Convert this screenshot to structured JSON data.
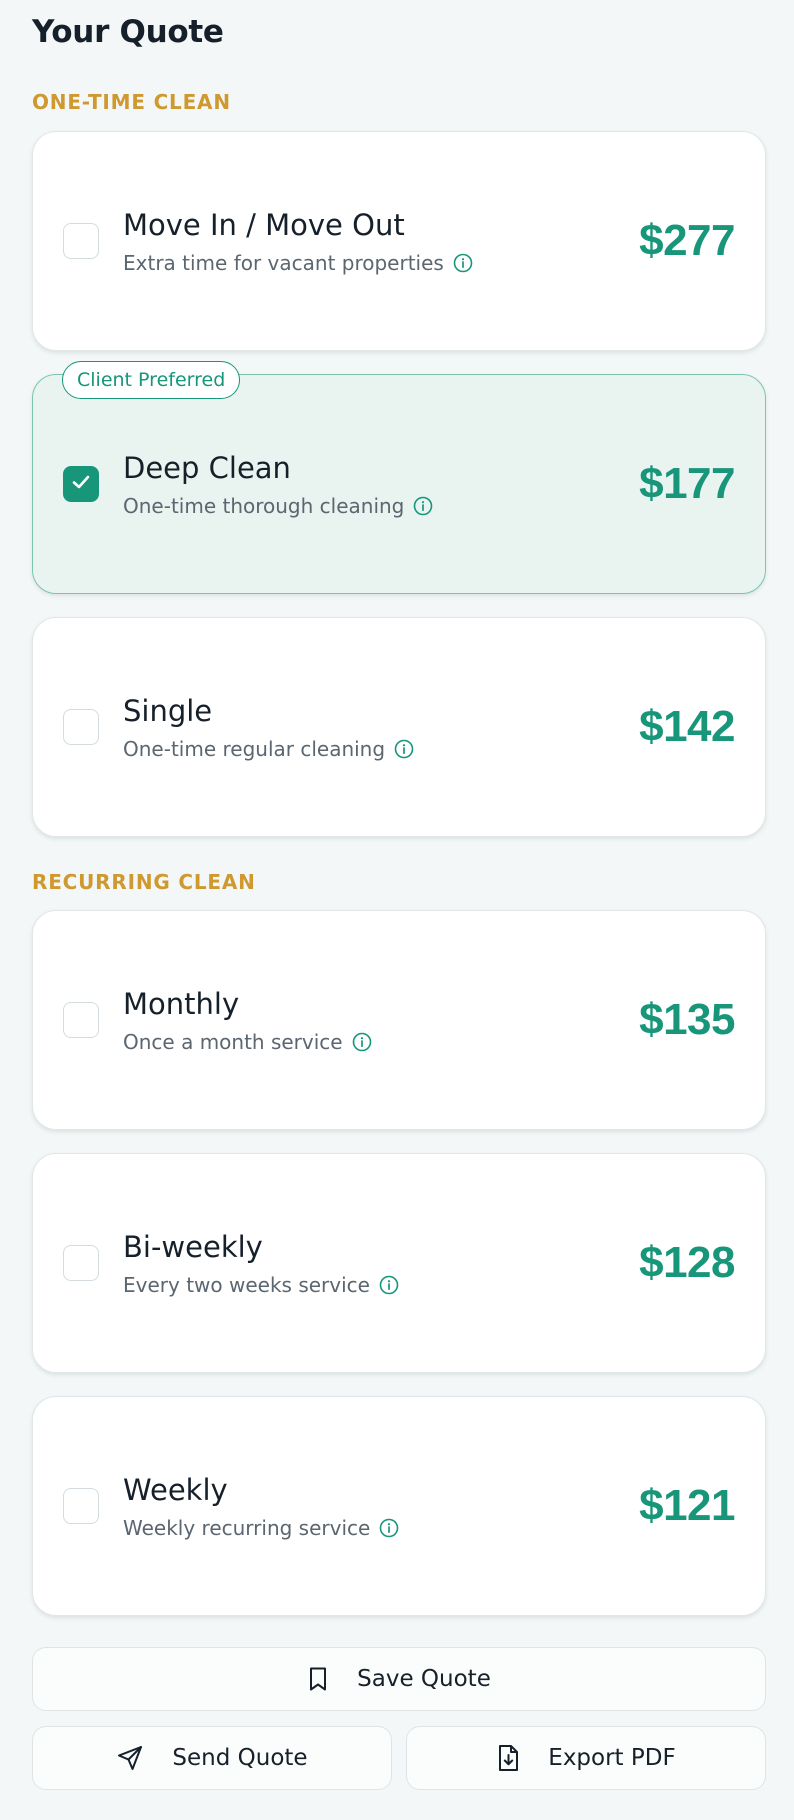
{
  "header": {
    "title": "Your Quote"
  },
  "sections": {
    "one_time": {
      "label": "ONE-TIME CLEAN"
    },
    "recurring": {
      "label": "RECURRING CLEAN"
    }
  },
  "cards": [
    {
      "title": "Move In / Move Out",
      "subtitle": "Extra time for vacant properties",
      "price": "$277",
      "selected": false
    },
    {
      "title": "Deep Clean",
      "subtitle": "One-time thorough cleaning",
      "price": "$177",
      "selected": true,
      "badge": "Client Preferred"
    },
    {
      "title": "Single",
      "subtitle": "One-time regular cleaning",
      "price": "$142",
      "selected": false
    },
    {
      "title": "Monthly",
      "subtitle": "Once a month service",
      "price": "$135",
      "selected": false
    },
    {
      "title": "Bi-weekly",
      "subtitle": "Every two weeks service",
      "price": "$128",
      "selected": false
    },
    {
      "title": "Weekly",
      "subtitle": "Weekly recurring service",
      "price": "$121",
      "selected": false
    }
  ],
  "actions": {
    "save_label": "Save Quote",
    "send_label": "Send Quote",
    "export_label": "Export PDF"
  },
  "icons": {
    "info": "info-circle-icon",
    "check": "check-icon",
    "save": "bookmark-icon",
    "send": "send-icon",
    "export": "file-download-icon"
  },
  "colors": {
    "accent": "#17967a",
    "section_label": "#cf9930",
    "selected_bg": "#e9f4f0",
    "background": "#f3f7f7"
  }
}
